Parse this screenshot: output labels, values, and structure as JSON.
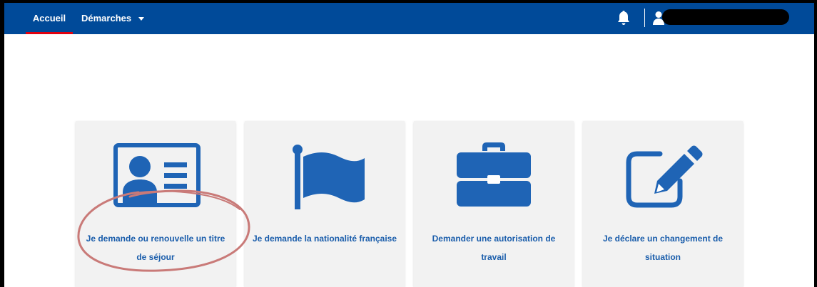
{
  "nav": {
    "home_label": "Accueil",
    "demarches_label": "Démarches",
    "bell_icon": "bell-icon",
    "user_icon": "user-icon",
    "colors": {
      "background": "#004a99",
      "active_underline": "#e1000f",
      "text": "#ffffff"
    }
  },
  "cards": [
    {
      "icon": "id-card-icon",
      "label": "Je demande ou renouvelle un titre de séjour"
    },
    {
      "icon": "flag-icon",
      "label": "Je demande la nationalité française"
    },
    {
      "icon": "briefcase-icon",
      "label": "Demander une autorisation de travail"
    },
    {
      "icon": "edit-icon",
      "label": "Je déclare un changement de situation"
    }
  ],
  "colors": {
    "icon_blue": "#1f64b5",
    "card_bg": "#f2f2f2",
    "label_blue": "#1a5dab",
    "annotation_circle": "#c97a78"
  }
}
